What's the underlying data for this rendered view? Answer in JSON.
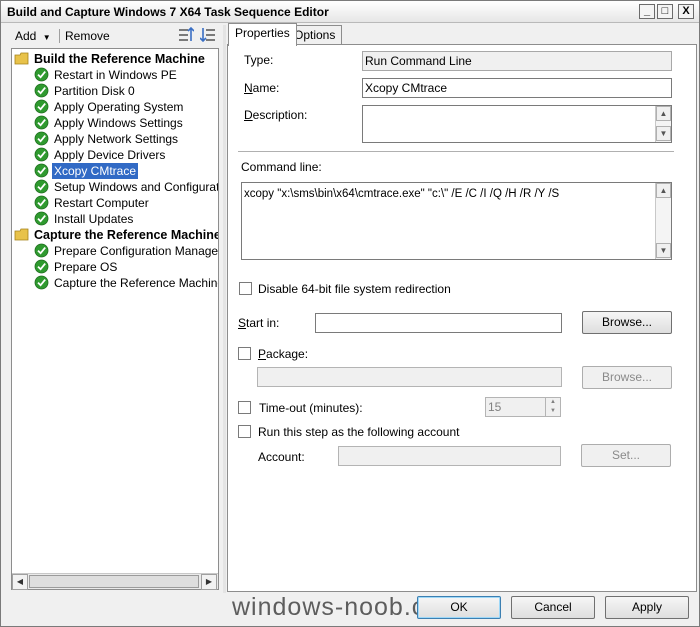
{
  "window": {
    "title": "Build and Capture Windows 7 X64 Task Sequence Editor",
    "buttons": [
      "_",
      "□",
      "X"
    ]
  },
  "toolbar": {
    "add_label": "Add",
    "remove_label": "Remove",
    "move_up_icon": "move-up-icon",
    "move_down_icon": "move-down-icon"
  },
  "tree": {
    "groups": [
      {
        "label": "Build the Reference Machine",
        "items": [
          "Restart in Windows PE",
          "Partition Disk 0",
          "Apply Operating System",
          "Apply Windows Settings",
          "Apply Network Settings",
          "Apply Device Drivers",
          "Xcopy CMtrace",
          "Setup Windows and Configuration",
          "Restart Computer",
          "Install Updates"
        ]
      },
      {
        "label": "Capture the Reference Machine",
        "items": [
          "Prepare Configuration Manager Cli",
          "Prepare OS",
          "Capture the Reference Machine"
        ]
      }
    ],
    "selected": "Xcopy CMtrace"
  },
  "tabs": [
    {
      "label": "Properties",
      "active": true
    },
    {
      "label": "Options",
      "active": false
    }
  ],
  "properties": {
    "type_label": "Type:",
    "type_value": "Run Command Line",
    "name_label_pre": "",
    "name_label_u": "N",
    "name_label_post": "ame:",
    "name_value": "Xcopy CMtrace",
    "description_label_pre": "",
    "description_label_u": "D",
    "description_label_post": "escription:",
    "description_value": "",
    "command_line_label": "Command line:",
    "command_line_value": "xcopy \"x:\\sms\\bin\\x64\\cmtrace.exe\" \"c:\\\" /E /C /I /Q /H /R /Y /S",
    "disable_redirection_label": "Disable 64-bit file system redirection",
    "start_in_label_u": "S",
    "start_in_label_post": "tart in:",
    "start_in_value": "",
    "browse_label": "Browse...",
    "package_label_u": "P",
    "package_label_post": "ackage:",
    "package_value": "",
    "package_browse_label": "Browse...",
    "timeout_label": "Time-out (minutes):",
    "timeout_value": "15",
    "run_as_label": "Run this step as the following account",
    "account_label": "Account:",
    "account_value": "",
    "set_label": "Set..."
  },
  "footer": {
    "ok_label": "OK",
    "cancel_label": "Cancel",
    "apply_label": "Apply",
    "watermark": "windows-noob.com"
  },
  "colors": {
    "selection": "#316ac5",
    "check_green": "#2f9a2f",
    "folder_yellow": "#e8c24a"
  }
}
